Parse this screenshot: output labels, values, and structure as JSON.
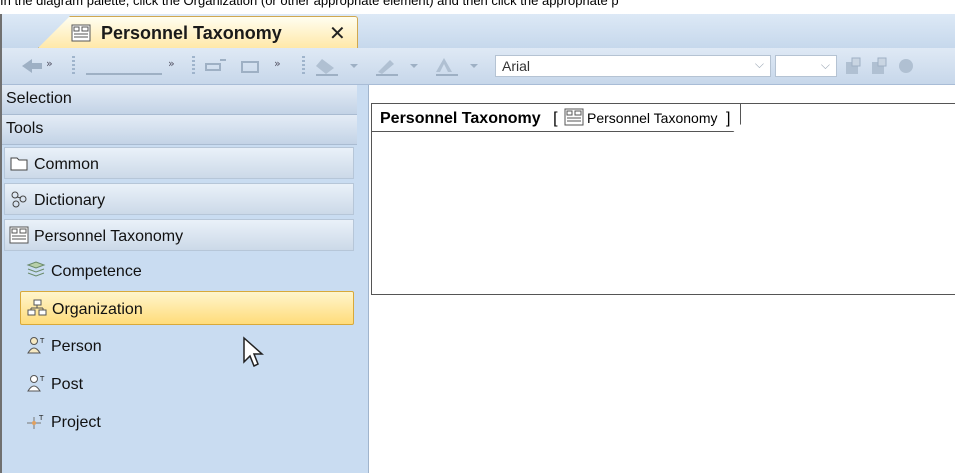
{
  "caption": "In the diagram palette, click the Organization (or other appropriate element) and then click the appropriate p",
  "tab": {
    "title": "Personnel Taxonomy",
    "close": "✕",
    "icon": "diagram-icon"
  },
  "toolbar": {
    "font_name": "Arial",
    "font_size": "",
    "dropdown_arrow": "⌵"
  },
  "palette": {
    "selection_label": "Selection",
    "tools_label": "Tools",
    "groups": [
      {
        "label": "Common",
        "icon": "folder-icon"
      },
      {
        "label": "Dictionary",
        "icon": "dictionary-icon"
      },
      {
        "label": "Personnel Taxonomy",
        "icon": "diagram-icon"
      }
    ],
    "items": [
      {
        "label": "Competence",
        "icon": "competence-icon"
      },
      {
        "label": "Organization",
        "icon": "organization-icon",
        "selected": true
      },
      {
        "label": "Person",
        "icon": "person-icon"
      },
      {
        "label": "Post",
        "icon": "post-icon"
      },
      {
        "label": "Project",
        "icon": "project-icon"
      }
    ]
  },
  "diagram": {
    "name": "Personnel Taxonomy",
    "bracket_open": "[",
    "type_label": "Personnel Taxonomy",
    "bracket_close": "]"
  },
  "colors": {
    "selected_item": "#ffdc7a",
    "palette_bg": "#c9dcf1",
    "tab_bg": "#ffe8a8"
  }
}
